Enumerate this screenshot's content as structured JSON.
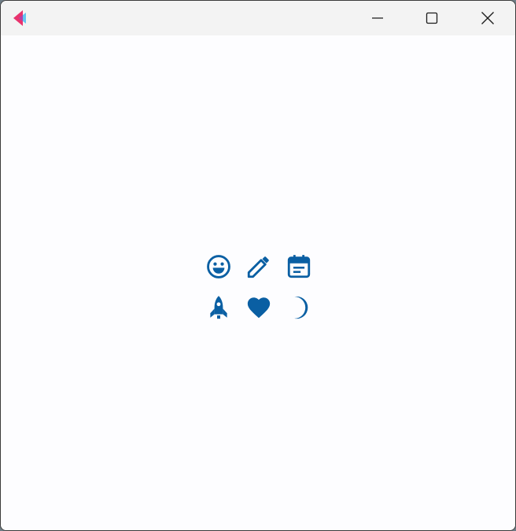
{
  "window": {
    "accent_color": "#0a5fa3",
    "logo_colors": {
      "left": "#e8336d",
      "right": "#5cc3f0"
    }
  },
  "titlebar": {
    "buttons": [
      {
        "name": "minimize-button",
        "icon": "minimize-icon"
      },
      {
        "name": "maximize-button",
        "icon": "maximize-icon"
      },
      {
        "name": "close-button",
        "icon": "close-icon"
      }
    ]
  },
  "icons": [
    {
      "name": "smiley-icon"
    },
    {
      "name": "pencil-icon"
    },
    {
      "name": "calendar-icon"
    },
    {
      "name": "rocket-icon"
    },
    {
      "name": "heart-icon"
    },
    {
      "name": "moon-icon"
    }
  ]
}
